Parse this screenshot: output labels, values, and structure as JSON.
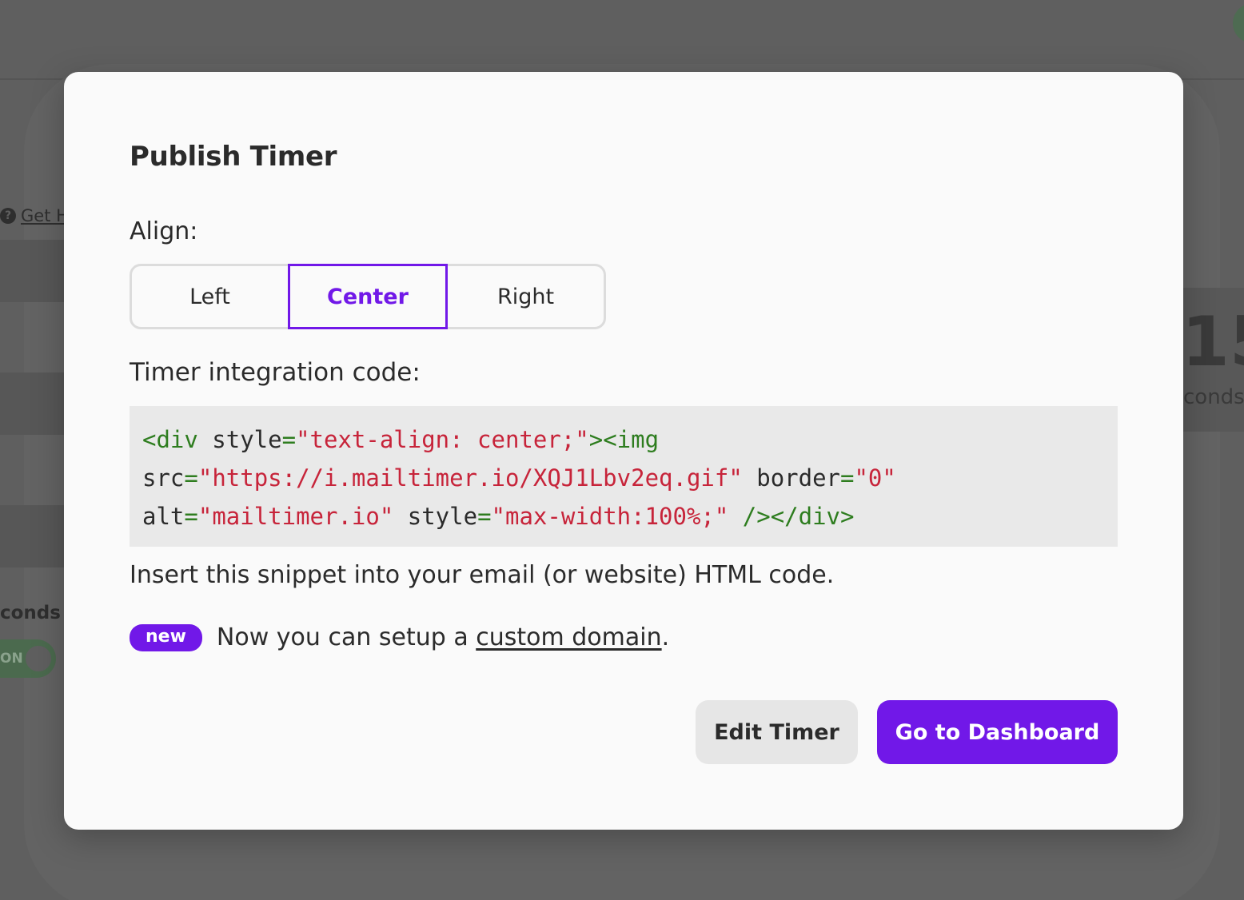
{
  "background": {
    "help_icon": "?",
    "help_link": "Get H",
    "seconds_left": "conds",
    "toggle_label": "ON",
    "big_number": "15",
    "seconds_right": "conds"
  },
  "modal": {
    "title": "Publish Timer",
    "align_label": "Align:",
    "align_options": [
      {
        "label": "Left",
        "selected": false
      },
      {
        "label": "Center",
        "selected": true
      },
      {
        "label": "Right",
        "selected": false
      }
    ],
    "code_label": "Timer integration code:",
    "code": {
      "l1_tag_open": "<div",
      "l1_attr1": " style",
      "l1_eq1": "=",
      "l1_str1": "\"text-align: center;\"",
      "l1_tag2": "><img",
      "l2_attr1": "src",
      "l2_eq1": "=",
      "l2_str1": "\"https://i.mailtimer.io/XQJ1Lbv2eq.gif\"",
      "l2_attr2": " border",
      "l2_eq2": "=",
      "l2_str2": "\"0\"",
      "l3_attr1": "alt",
      "l3_eq1": "=",
      "l3_str1": "\"mailtimer.io\"",
      "l3_attr2": " style",
      "l3_eq2": "=",
      "l3_str2": "\"max-width:100%;\"",
      "l3_tag_close": " /></div>"
    },
    "insert_text": "Insert this snippet into your email (or website) HTML code.",
    "new_badge": "new",
    "new_text_before": "Now you can setup a ",
    "new_link": "custom domain",
    "new_text_after": ".",
    "edit_button": "Edit Timer",
    "dashboard_button": "Go to Dashboard"
  },
  "colors": {
    "accent": "#7118e8",
    "overlay": "#5f5f5f",
    "modal_bg": "#fafafa",
    "code_bg": "#e9e9e9",
    "code_tag": "#2e7d1f",
    "code_string": "#c7243a"
  }
}
